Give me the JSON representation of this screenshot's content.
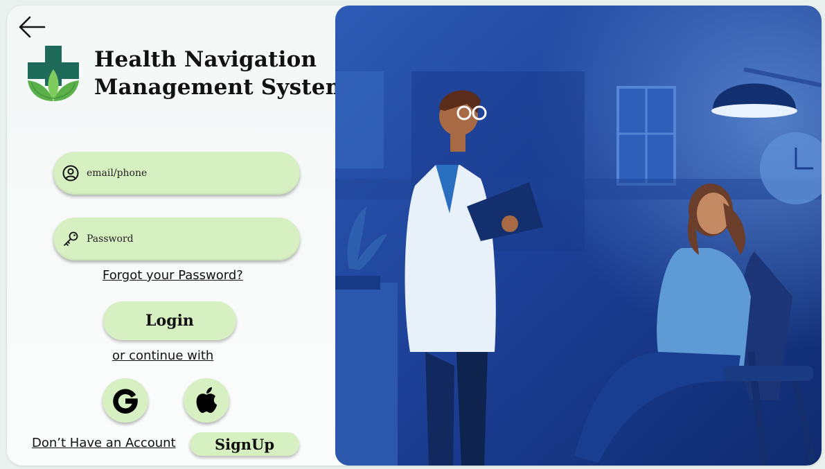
{
  "app": {
    "title_line1": "Health  Navigation",
    "title_line2": "Management System"
  },
  "icons": {
    "back": "arrow-left-icon",
    "logo": "medical-cross-leaf-logo",
    "email": "user-circle-icon",
    "password": "key-icon",
    "google": "google-icon",
    "apple": "apple-icon"
  },
  "form": {
    "email_placeholder": "email/phone",
    "password_placeholder": "Password",
    "forgot_link": "Forgot your Password?",
    "login_label": "Login",
    "continue_with": "or continue with",
    "no_account": "Don’t Have an Account",
    "signup_label": "SignUp"
  },
  "colors": {
    "accent_green": "#d6f0c2",
    "logo_teal": "#1f6b5a",
    "logo_leaf": "#5bb04a",
    "illustration_bg": "#1b3f8f"
  }
}
